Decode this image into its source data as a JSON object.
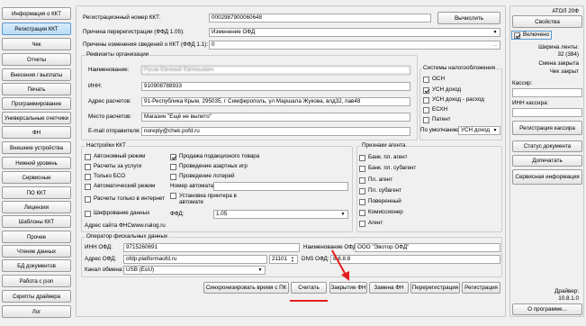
{
  "nav": [
    "Информация о ККТ",
    "Регистрация ККТ",
    "Чек",
    "Отчеты",
    "Внесения / выплаты",
    "Печать",
    "Программирование",
    "Универсальные счетчики",
    "ФН",
    "Внешние устройства",
    "Нижний уровень",
    "Сервисные",
    "ПО ККТ",
    "Лицензии",
    "Шаблоны ККТ",
    "Прочее",
    "Чтение данных",
    "БД документов",
    "Работа с json",
    "Скрипты драйвера",
    "Лог"
  ],
  "reg": {
    "regnum_label": "Регистрационный номер ККТ:",
    "regnum_value": "0002987900060648",
    "calc_button": "Вычислить",
    "reason_label": "Причина перерегистрации (ФФД 1.05):",
    "reason_value": "Изменение ОФД",
    "changes_label": "Причины изменения сведений о ККТ (ФФД 1.1):",
    "changes_value": "0"
  },
  "org": {
    "title": "Реквизиты организации",
    "name_label": "Наименование:",
    "name_value": "Русак Евгений Евгеньевич",
    "inn_label": "ИНН:",
    "inn_value": "910908788933",
    "addr_label": "Адрес расчетов:",
    "addr_value": "91-Республика Крым, 295035, г Симферополь, ул Маршала Жукова, влд32, пав48",
    "place_label": "Место расчетов:",
    "place_value": "Магазин \"Ещё не выпито\"",
    "email_label": "E-mail отправителя:",
    "email_value": "noreply@chek.pofd.ru"
  },
  "tax": {
    "title": "Системы налогообложения",
    "items": [
      {
        "label": "ОСН",
        "checked": false
      },
      {
        "label": "УСН доход",
        "checked": true
      },
      {
        "label": "УСН доход - расход",
        "checked": false
      },
      {
        "label": "ЕСХН",
        "checked": false
      },
      {
        "label": "Патент",
        "checked": false
      }
    ],
    "default_label": "По умолчанию:",
    "default_value": "УСН доход"
  },
  "settings": {
    "title": "Настройки ККТ",
    "left": [
      {
        "label": "Автономный режим",
        "checked": false
      },
      {
        "label": "Расчеты за услуги",
        "checked": false
      },
      {
        "label": "Только БСО",
        "checked": false
      },
      {
        "label": "Автоматический режим",
        "checked": false
      },
      {
        "label": "Расчеты только в интернет",
        "checked": false
      },
      {
        "label": "Шифрование данных",
        "checked": false
      }
    ],
    "right": [
      {
        "label": "Продажа подакцизного товара",
        "checked": true
      },
      {
        "label": "Проведение азартных игр",
        "checked": false
      },
      {
        "label": "Проведение лотерей",
        "checked": false
      }
    ],
    "auto_num_label": "Номер автомата:",
    "printer_label": "Установка принтера в автомате",
    "ffd_label": "ФФД:",
    "ffd_value": "1.05",
    "fns_label": "Адрес сайта ФНС:",
    "fns_value": "www.nalog.ru"
  },
  "agent": {
    "title": "Признаки агента",
    "items": [
      "Банк. пл. агент",
      "Банк. пл. субагент",
      "Пл. агент",
      "Пл. субагент",
      "Поверенный",
      "Комиссионер",
      "Агент"
    ]
  },
  "ofd": {
    "title": "Оператор фискальных данных",
    "inn_label": "ИНН ОФД:",
    "inn_value": "9715260691",
    "name_label": "Наименование ОФД:",
    "name_value": "ООО \"Эвотор ОФД\"",
    "addr_label": "Адрес ОФД:",
    "addr_value": "ofdp.platformaofd.ru",
    "port_value": "21101",
    "dns_label": "DNS ОФД:",
    "dns_value": "8.8.8.8",
    "channel_label": "Канал обмена:",
    "channel_value": "USB (EoU)"
  },
  "actions": [
    "Синхронизировать время с ПК",
    "Считать",
    "Закрытие ФН",
    "Замена ФН",
    "Перерегистрация",
    "Регистрация"
  ],
  "right": {
    "device": "АТОЛ 20Ф",
    "props_button": "Свойства",
    "enabled_label": "Включено",
    "tape_label": "Ширина ленты:",
    "tape_value": "32 (384)",
    "shift": "Смена закрыта",
    "check": "Чек закрыт",
    "cashier_label": "Кассир:",
    "cashier_inn_label": "ИНН кассира:",
    "reg_cashier_button": "Регистрация кассира",
    "doc_status_button": "Статус документа",
    "reprint_button": "Допечатать",
    "service_info_button": "Сервисная информация",
    "driver_label": "Драйвер:",
    "driver_version": "10.8.1.0",
    "about_button": "О программе..."
  },
  "accent": "#e51d1d"
}
